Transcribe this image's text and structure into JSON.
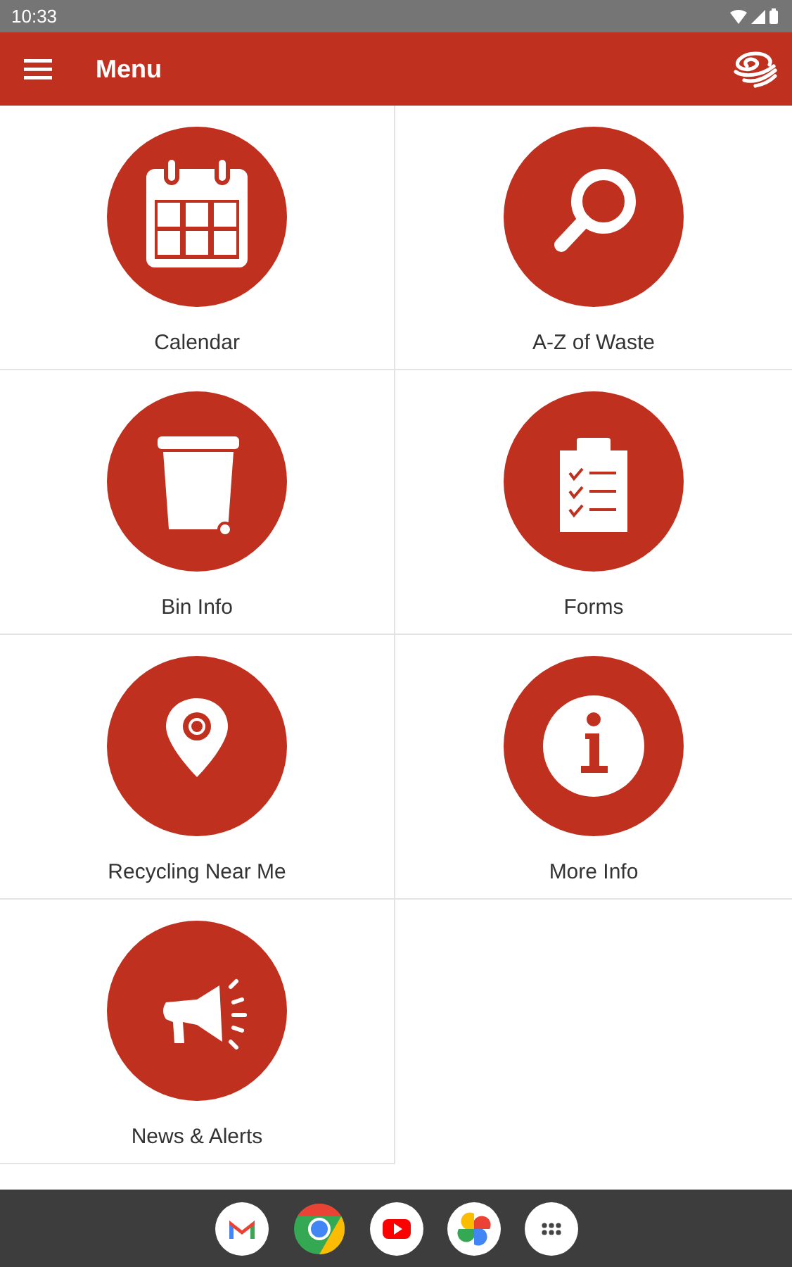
{
  "status_bar": {
    "time": "10:33"
  },
  "app_bar": {
    "title": "Menu"
  },
  "tiles": [
    {
      "kind": "calendar",
      "label": "Calendar"
    },
    {
      "kind": "search",
      "label": "A-Z of Waste"
    },
    {
      "kind": "bin",
      "label": "Bin Info"
    },
    {
      "kind": "forms",
      "label": "Forms"
    },
    {
      "kind": "location",
      "label": "Recycling Near Me"
    },
    {
      "kind": "info",
      "label": "More Info"
    },
    {
      "kind": "megaphone",
      "label": "News & Alerts"
    }
  ],
  "dock": [
    {
      "kind": "mail"
    },
    {
      "kind": "browser"
    },
    {
      "kind": "video"
    },
    {
      "kind": "photos"
    },
    {
      "kind": "apps"
    }
  ]
}
